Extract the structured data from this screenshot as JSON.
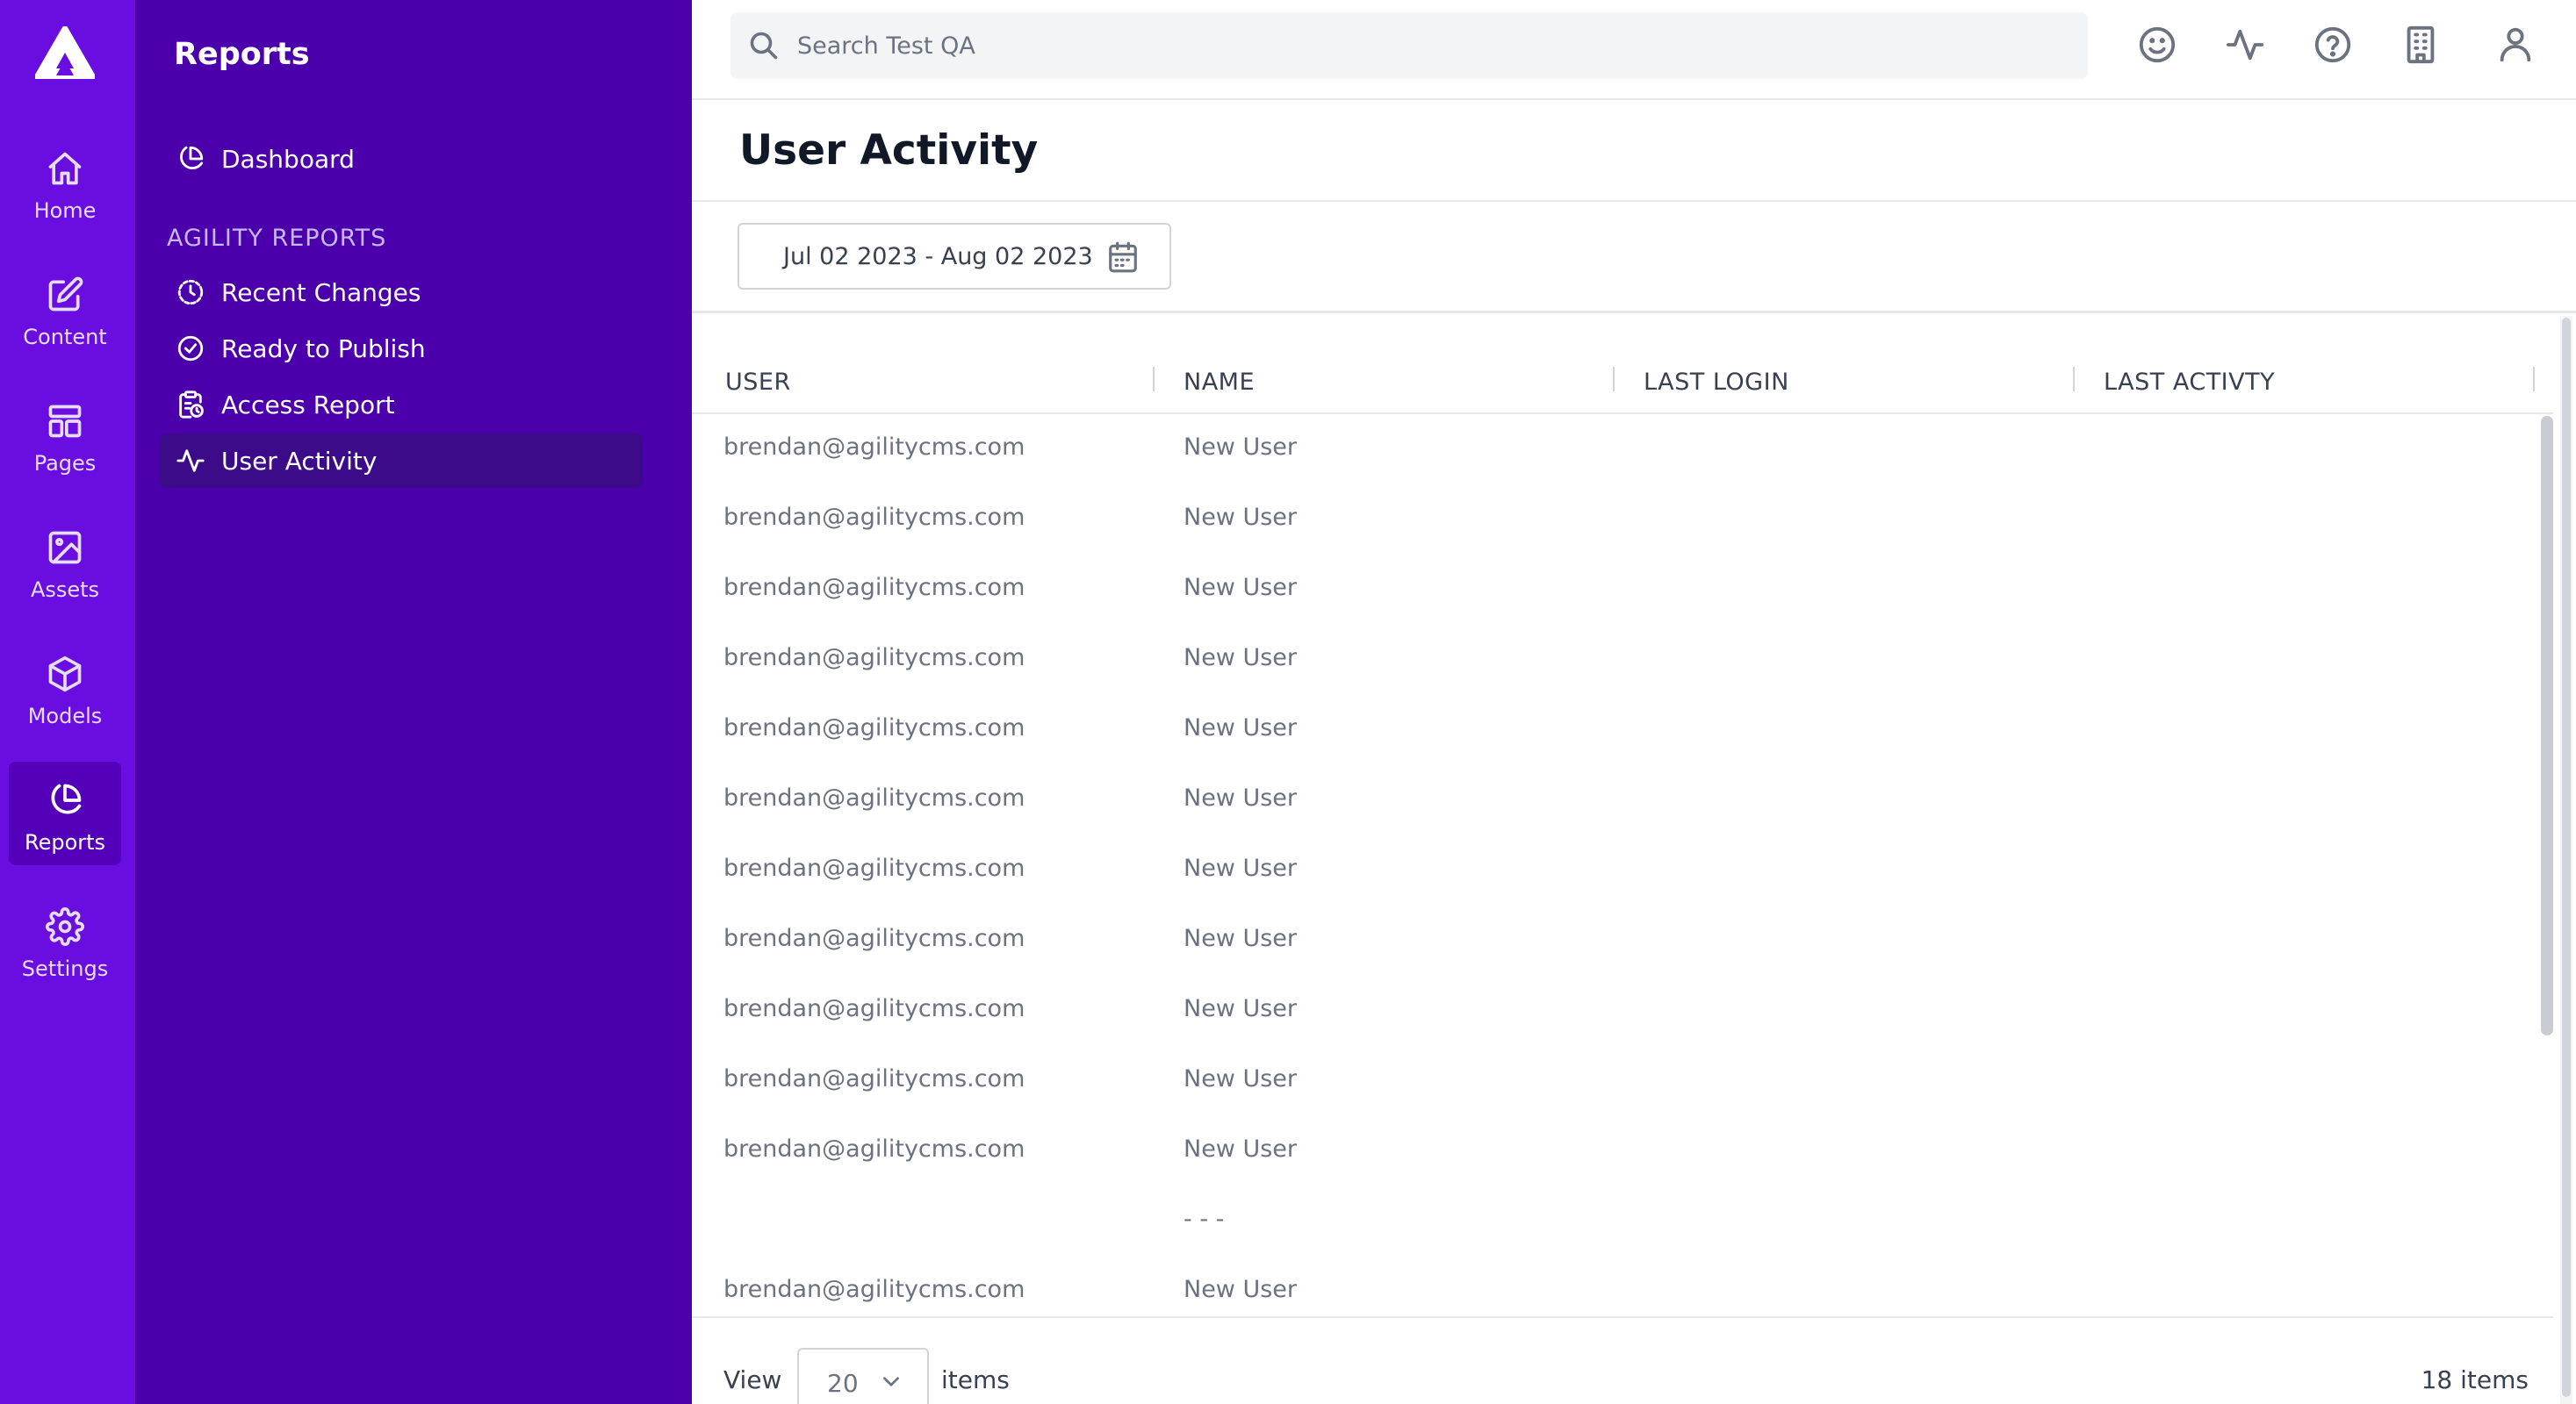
{
  "rail": {
    "items": [
      {
        "label": "Home",
        "icon": "home-icon"
      },
      {
        "label": "Content",
        "icon": "edit-icon"
      },
      {
        "label": "Pages",
        "icon": "layout-icon"
      },
      {
        "label": "Assets",
        "icon": "image-icon"
      },
      {
        "label": "Models",
        "icon": "cube-icon"
      },
      {
        "label": "Reports",
        "icon": "pie-chart-icon",
        "active": true
      },
      {
        "label": "Settings",
        "icon": "gear-icon"
      }
    ]
  },
  "subnav": {
    "title": "Reports",
    "dashboard_label": "Dashboard",
    "section_label": "AGILITY REPORTS",
    "items": [
      {
        "label": "Recent Changes",
        "icon": "history-icon"
      },
      {
        "label": "Ready to Publish",
        "icon": "check-circle-icon"
      },
      {
        "label": "Access Report",
        "icon": "clipboard-clock-icon"
      },
      {
        "label": "User Activity",
        "icon": "activity-icon",
        "active": true
      }
    ]
  },
  "search": {
    "placeholder": "Search Test QA"
  },
  "page": {
    "title": "User Activity"
  },
  "date_range": {
    "label": "Jul 02 2023 - Aug 02 2023"
  },
  "table": {
    "headers": [
      "USER",
      "NAME",
      "LAST LOGIN",
      "LAST ACTIVTY"
    ],
    "rows": [
      {
        "user": "brendan@agilitycms.com",
        "name": "New User"
      },
      {
        "user": "brendan@agilitycms.com",
        "name": "New User"
      },
      {
        "user": "brendan@agilitycms.com",
        "name": "New User"
      },
      {
        "user": "brendan@agilitycms.com",
        "name": "New User"
      },
      {
        "user": "brendan@agilitycms.com",
        "name": "New User"
      },
      {
        "user": "brendan@agilitycms.com",
        "name": "New User"
      },
      {
        "user": "brendan@agilitycms.com",
        "name": "New User"
      },
      {
        "user": "brendan@agilitycms.com",
        "name": "New User"
      },
      {
        "user": "brendan@agilitycms.com",
        "name": "New User"
      },
      {
        "user": "brendan@agilitycms.com",
        "name": "New User"
      },
      {
        "user": "brendan@agilitycms.com",
        "name": "New User"
      },
      {
        "user": "",
        "name": "- - -"
      },
      {
        "user": "brendan@agilitycms.com",
        "name": "New User"
      }
    ]
  },
  "footer": {
    "view_label": "View",
    "page_size": "20",
    "items_label": "items",
    "total": "18 items"
  },
  "colors": {
    "rail_bg": "#6a0de0",
    "subnav_bg": "#4b00ab",
    "active_item_bg": "#3c0b8a"
  }
}
